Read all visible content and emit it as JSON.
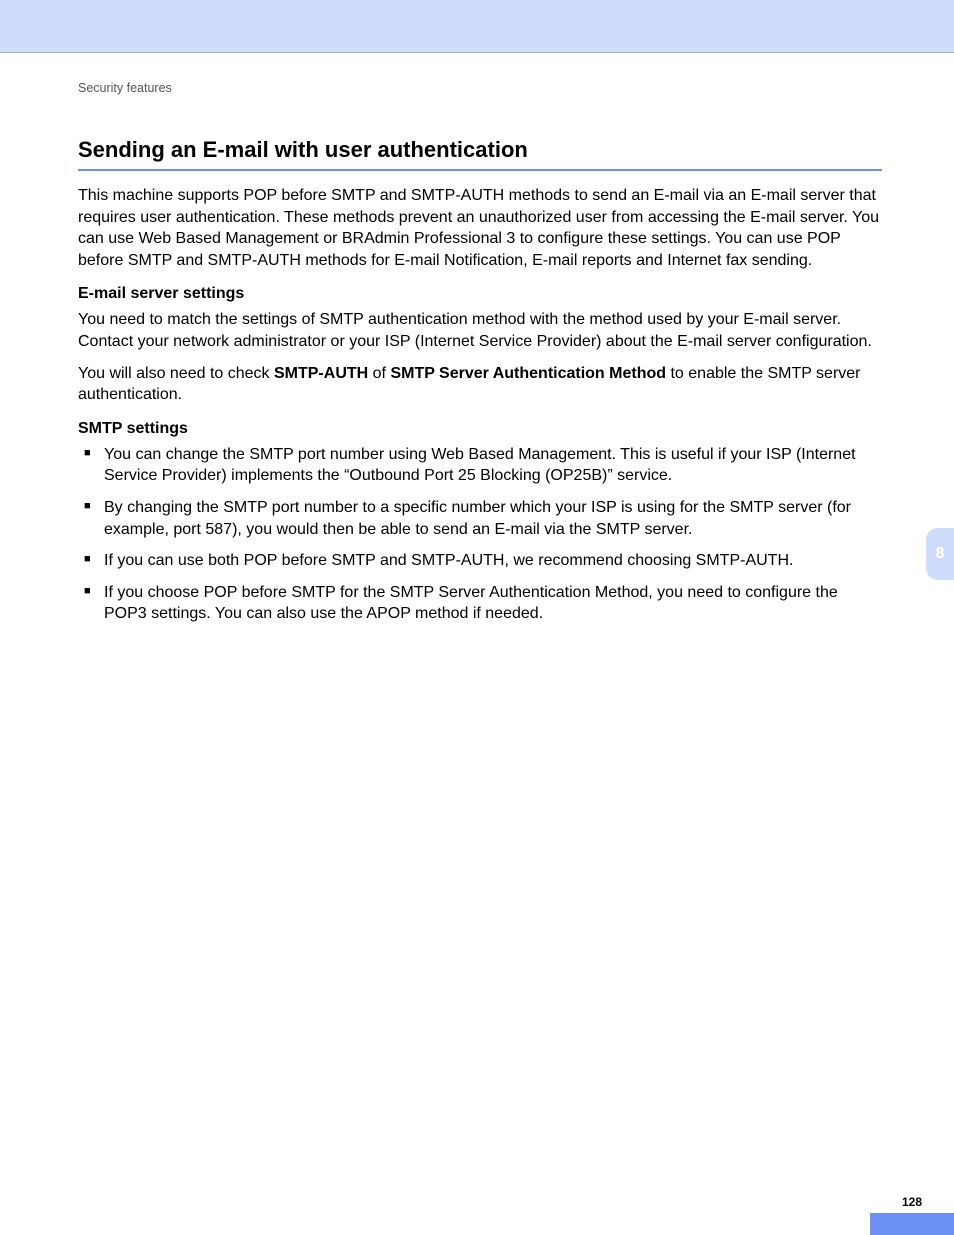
{
  "header": {
    "breadcrumb": "Security features"
  },
  "title": "Sending an E-mail with user authentication",
  "intro": "This machine supports POP before SMTP and SMTP-AUTH methods to send an E-mail via an E-mail server that requires user authentication. These methods prevent an unauthorized user from accessing the E-mail server. You can use Web Based Management or BRAdmin Professional 3 to configure these settings. You can use POP before SMTP and SMTP-AUTH methods for E-mail Notification, E-mail reports and Internet fax sending.",
  "section1": {
    "heading": "E-mail server settings",
    "p1": "You need to match the settings of SMTP authentication method with the method used by your E-mail server. Contact your network administrator or your ISP (Internet Service Provider) about the E-mail server configuration.",
    "p2_pre": "You will also need to check ",
    "p2_b1": "SMTP-AUTH",
    "p2_mid": " of ",
    "p2_b2": "SMTP Server Authentication Method",
    "p2_post": " to enable the SMTP server authentication."
  },
  "section2": {
    "heading": "SMTP settings",
    "bullets": [
      "You can change the SMTP port number using Web Based Management. This is useful if your ISP (Internet Service Provider) implements the “Outbound Port 25 Blocking (OP25B)” service.",
      "By changing the SMTP port number to a specific number which your ISP is using for the SMTP server (for example, port 587), you would then be able to send an E-mail via the SMTP server.",
      "If you can use both POP before SMTP and SMTP-AUTH, we recommend choosing SMTP-AUTH.",
      "If you choose POP before SMTP for the SMTP Server Authentication Method, you need to configure the POP3 settings. You can also use the APOP method if needed."
    ]
  },
  "chapter_tab": "8",
  "page_number": "128"
}
